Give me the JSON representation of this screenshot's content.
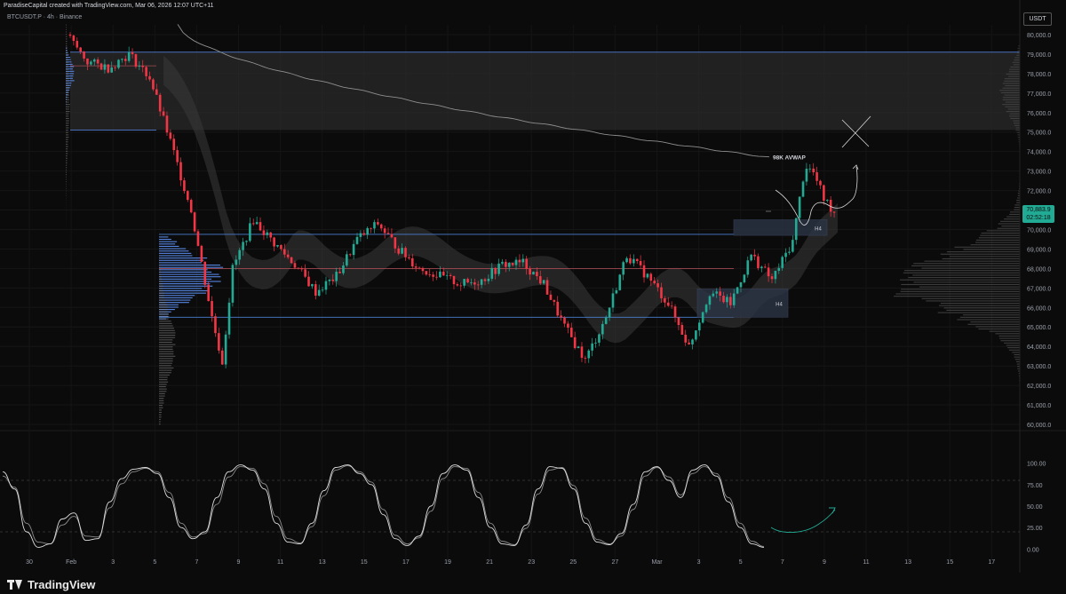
{
  "header": {
    "credit": "ParadiseCapital created with TradingView.com, Mar 06, 2026 12:07 UTC+11",
    "symbol": "BTCUSDT.P · 4h · Binance"
  },
  "price_axis": {
    "currency": "USDT"
  },
  "last_price": {
    "value": "70,883.9",
    "countdown": "02:52:18",
    "color": "#22ab94"
  },
  "footer": {
    "brand": "TradingView"
  },
  "colors": {
    "up": "#22ab94",
    "down": "#f23645",
    "profile": "#5b8def",
    "background": "#0b0b0b",
    "zone": "#2b3445"
  },
  "chart_data": [
    {
      "type": "candlestick",
      "interval": "4h",
      "ylim": [
        60000,
        80500
      ],
      "y_ticks": [
        "80,000.0",
        "79,000.0",
        "78,000.0",
        "77,000.0",
        "76,000.0",
        "75,000.0",
        "74,000.0",
        "73,000.0",
        "72,000.0",
        "71,000.0",
        "70,000.0",
        "69,000.0",
        "68,000.0",
        "67,000.0",
        "66,000.0",
        "65,000.0",
        "64,000.0",
        "63,000.0",
        "62,000.0",
        "61,000.0",
        "60,000.0"
      ],
      "x_ticks": [
        "30",
        "Feb",
        "3",
        "5",
        "7",
        "9",
        "11",
        "13",
        "15",
        "17",
        "19",
        "21",
        "23",
        "25",
        "27",
        "Mar",
        "3",
        "5",
        "7",
        "9",
        "11",
        "13",
        "15",
        "17"
      ],
      "close_path": [
        {
          "t": 0,
          "v": 80000
        },
        {
          "t": 1,
          "v": 78600
        },
        {
          "t": 2,
          "v": 78300
        },
        {
          "t": 3,
          "v": 79000
        },
        {
          "t": 4,
          "v": 77800
        },
        {
          "t": 5,
          "v": 74500
        },
        {
          "t": 6,
          "v": 71000
        },
        {
          "t": 7,
          "v": 65500
        },
        {
          "t": 7.5,
          "v": 63200
        },
        {
          "t": 8,
          "v": 68000
        },
        {
          "t": 9,
          "v": 70500
        },
        {
          "t": 10,
          "v": 69300
        },
        {
          "t": 11,
          "v": 68200
        },
        {
          "t": 12,
          "v": 66800
        },
        {
          "t": 13,
          "v": 67600
        },
        {
          "t": 14,
          "v": 69500
        },
        {
          "t": 15,
          "v": 70300
        },
        {
          "t": 16,
          "v": 69000
        },
        {
          "t": 17,
          "v": 68000
        },
        {
          "t": 18,
          "v": 67600
        },
        {
          "t": 19,
          "v": 67200
        },
        {
          "t": 20,
          "v": 67400
        },
        {
          "t": 21,
          "v": 68200
        },
        {
          "t": 22,
          "v": 68300
        },
        {
          "t": 23,
          "v": 67200
        },
        {
          "t": 24,
          "v": 65000
        },
        {
          "t": 25,
          "v": 63300
        },
        {
          "t": 26,
          "v": 65500
        },
        {
          "t": 27,
          "v": 68700
        },
        {
          "t": 28,
          "v": 67600
        },
        {
          "t": 29,
          "v": 66200
        },
        {
          "t": 30,
          "v": 64000
        },
        {
          "t": 31,
          "v": 66800
        },
        {
          "t": 32,
          "v": 66200
        },
        {
          "t": 33,
          "v": 68700
        },
        {
          "t": 34,
          "v": 67400
        },
        {
          "t": 35,
          "v": 69400
        },
        {
          "t": 35.6,
          "v": 73300
        },
        {
          "t": 36,
          "v": 72900
        },
        {
          "t": 36.5,
          "v": 71600
        },
        {
          "t": 37,
          "v": 70900
        }
      ],
      "horizontal_levels": [
        69750,
        68000,
        65500
      ],
      "resistance_zone": [
        75100,
        79100
      ],
      "h4_zones": [
        {
          "from": 69700,
          "to": 70500,
          "label": "H4"
        },
        {
          "from": 65500,
          "to": 66950,
          "label": "H4"
        }
      ],
      "avwap": {
        "label": "98K AVWAP",
        "start": 80500,
        "end": 73700
      },
      "annotations": {
        "avwap_label": "98K AVWAP",
        "zone_label": "H4"
      }
    },
    {
      "type": "line",
      "indicator": "stochastic",
      "ylim": [
        -10,
        110
      ],
      "y_ticks": [
        "100.00",
        "75.00",
        "50.00",
        "25.00",
        "0.00"
      ],
      "levels": [
        80,
        20
      ],
      "k_values": [
        90,
        70,
        20,
        2,
        6,
        35,
        42,
        10,
        12,
        55,
        82,
        93,
        95,
        88,
        60,
        25,
        12,
        20,
        60,
        90,
        98,
        92,
        70,
        30,
        8,
        6,
        30,
        68,
        95,
        98,
        88,
        75,
        40,
        12,
        4,
        15,
        50,
        88,
        98,
        92,
        60,
        25,
        6,
        4,
        28,
        70,
        96,
        94,
        70,
        30,
        8,
        5,
        18,
        52,
        90,
        96,
        80,
        60,
        92,
        98,
        85,
        55,
        25,
        6,
        2
      ],
      "d_values": [
        85,
        72,
        30,
        8,
        6,
        28,
        38,
        15,
        14,
        48,
        76,
        90,
        94,
        90,
        66,
        30,
        14,
        18,
        52,
        84,
        96,
        94,
        76,
        38,
        12,
        7,
        26,
        62,
        92,
        97,
        90,
        78,
        46,
        16,
        6,
        13,
        44,
        82,
        96,
        94,
        66,
        30,
        9,
        5,
        24,
        64,
        92,
        95,
        74,
        36,
        11,
        6,
        15,
        46,
        85,
        95,
        84,
        63,
        88,
        96,
        88,
        60,
        30,
        9,
        3
      ],
      "curve_annotation": "projected-curl-up"
    }
  ]
}
